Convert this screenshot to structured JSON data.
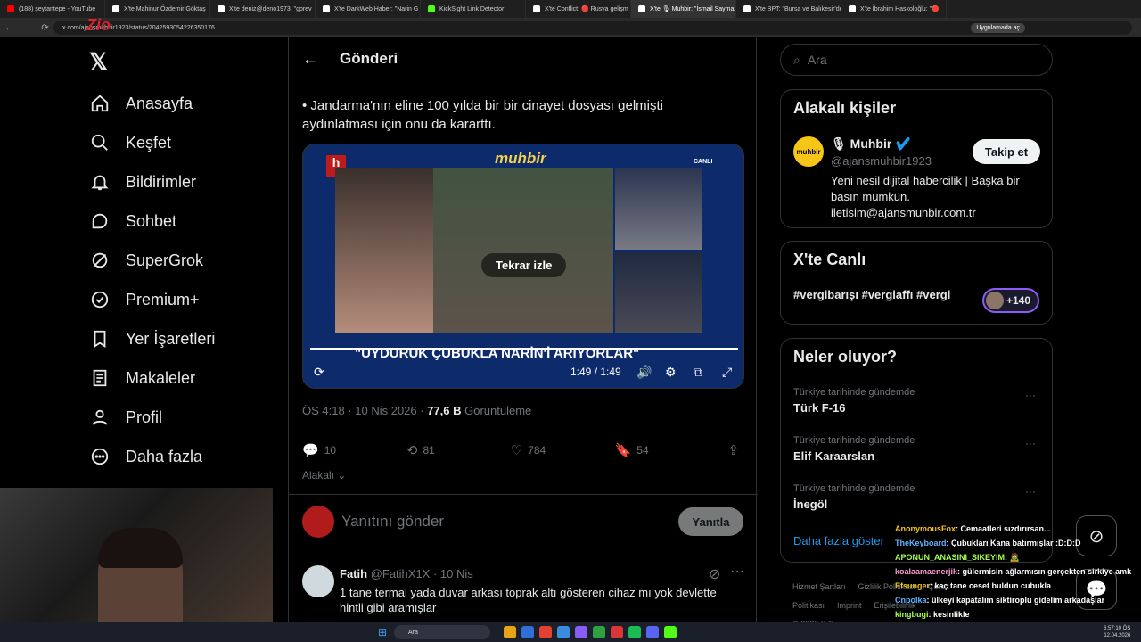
{
  "browser": {
    "tabs": [
      {
        "title": "(188) şeytantepe - YouTube",
        "color": "#ff0000"
      },
      {
        "title": "X'te Mahinur Özdemir Göktaş",
        "color": "#ffffff"
      },
      {
        "title": "X'te deniz@deno1973: \"gorev",
        "color": "#ffffff"
      },
      {
        "title": "X'te DarkWeb Haber: \"Narin G",
        "color": "#ffffff"
      },
      {
        "title": "KickSight Link Detector",
        "color": "#53fc18"
      },
      {
        "title": "X'te Conflict: 🔴 Rusya gelişm",
        "color": "#ffffff"
      },
      {
        "title": "X'te 🎙 Muhbir: \"İsmail Saymaz",
        "color": "#ffffff"
      },
      {
        "title": "X'te BPT: \"Bursa ve Balıkesir'de",
        "color": "#ffffff"
      },
      {
        "title": "X'te İbrahim Haskoloğlu: \"🔴",
        "color": "#ffffff"
      }
    ],
    "url": "x.com/ajansmuhbir1923/status/2042593054226350176",
    "app_pill": "Uygulamada aç"
  },
  "nav": {
    "items": [
      {
        "label": "Anasayfa",
        "icon": "home-icon"
      },
      {
        "label": "Keşfet",
        "icon": "search-icon"
      },
      {
        "label": "Bildirimler",
        "icon": "bell-icon"
      },
      {
        "label": "Sohbet",
        "icon": "chat-icon"
      },
      {
        "label": "SuperGrok",
        "icon": "grok-icon"
      },
      {
        "label": "Premium+",
        "icon": "verified-icon"
      },
      {
        "label": "Yer İşaretleri",
        "icon": "bookmark-icon"
      },
      {
        "label": "Makaleler",
        "icon": "article-icon"
      },
      {
        "label": "Profil",
        "icon": "person-icon"
      },
      {
        "label": "Daha fazla",
        "icon": "more-icon"
      }
    ]
  },
  "post": {
    "header": "Gönderi",
    "text": "• Jandarma'nın eline 100 yılda bir bir cinayet dosyası gelmişti aydınlatması için onu da kararttı.",
    "video": {
      "brand": "muhbir",
      "live_label": "CANLI",
      "channel": "h",
      "headline": "\"UYDURUK ÇUBUKLA NARİN'İ ARIYORLAR\"",
      "replay": "Tekrar izle",
      "time": "1:49 / 1:49",
      "progress": 1.0
    },
    "meta": {
      "time": "ÖS 4:18 · 10 Nis 2026 · ",
      "views": "77,6 B",
      "views_label": " Görüntüleme"
    },
    "actions": {
      "replies": "10",
      "reposts": "81",
      "likes": "784",
      "bookmarks": "54"
    },
    "relevance": "Alakalı",
    "reply_placeholder": "Yanıtını gönder",
    "reply_button": "Yanıtla"
  },
  "reply": {
    "name": "Fatih",
    "handle": "@FatihX1X · 10 Nis",
    "text": "1 tane termal yada duvar arkası toprak altı gösteren cihaz mı yok devlette hintli gibi aramışlar"
  },
  "sidebar": {
    "search_placeholder": "Ara",
    "people_title": "Alakalı kişiler",
    "profile": {
      "avatar_text": "muhbir",
      "name": "🎙 Muhbir",
      "handle": "@ajansmuhbir1923",
      "follow": "Takip et",
      "bio": "Yeni nesil dijital habercilik | Başka bir basın mümkün. iletisim@ajansmuhbir.com.tr"
    },
    "live_title": "X'te Canlı",
    "live_tags": "#vergibarışı #vergiaffı #vergi",
    "live_count": "+140",
    "trends_title": "Neler oluyor?",
    "trends": [
      {
        "context": "Türkiye tarihinde gündemde",
        "topic": "Türk F-16"
      },
      {
        "context": "Türkiye tarihinde gündemde",
        "topic": "Elif Karaarslan"
      },
      {
        "context": "Türkiye tarihinde gündemde",
        "topic": "İnegöl"
      }
    ],
    "more": "Daha fazla göster",
    "footer": {
      "links": [
        "Hizmet Şartları",
        "Gizlilik Politikası",
        "Çerez Politikası",
        "Imprint",
        "Erişilebilirlik"
      ],
      "copyright": "© 2026 X Corp."
    }
  },
  "chat": [
    {
      "user": "AnonymousFox",
      "msg": ": Cemaatleri sızdırırsan..."
    },
    {
      "user": "TheKeyboard",
      "msg": ": Çubukları Kana batırmışlar :D:D:D"
    },
    {
      "user": "APONUN_ANASINI_SIKEYIM",
      "msg": ": 🧟"
    },
    {
      "user": "koalaamaenerjik",
      "msg": ": gülermisin ağlarmısın gerçekten sirkiye amk"
    },
    {
      "user": "Efsunger",
      "msg": ": kaç tane ceset buldun cubukla"
    },
    {
      "user": "Cnpolka",
      "msg": ": ülkeyi kapatalım siktiroplu gidelim arkadaşlar"
    },
    {
      "user": "kingbugi",
      "msg": ": kesinlikle"
    }
  ],
  "taskbar": {
    "search": "Ara",
    "time": "6:57:10 ÖS",
    "date": "12.04.2026"
  },
  "watermark": "Zio"
}
